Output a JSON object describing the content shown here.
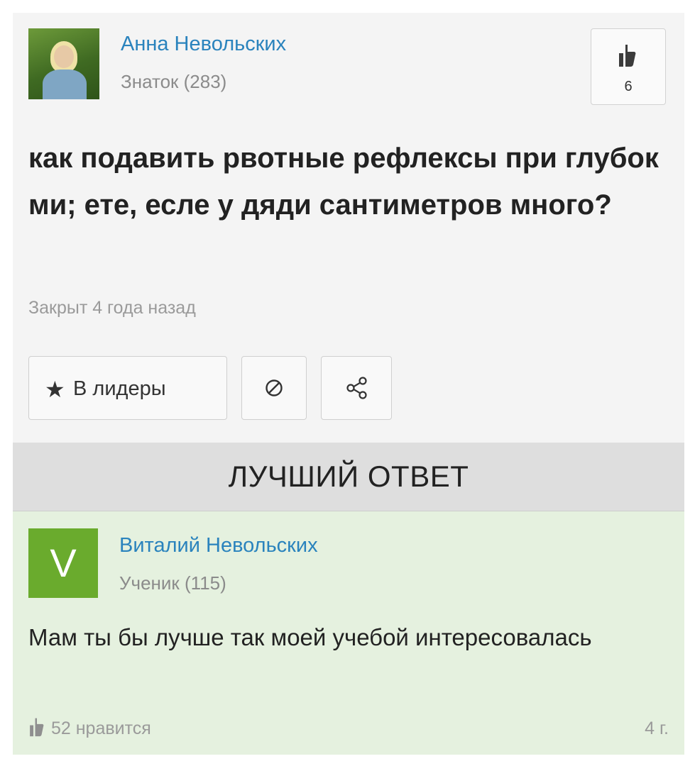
{
  "question": {
    "author_name": "Анна Невольских",
    "author_rank": "Знаток (283)",
    "like_count": "6",
    "text": "как подавить рвотные рефлексы при глубок ми; ете, есле у дяди сантиметров много?",
    "closed_text": "Закрыт 4 года назад",
    "leaders_button_label": "В лидеры",
    "star_icon": "★"
  },
  "best_answer": {
    "banner_title": "ЛУЧШИЙ ОТВЕТ",
    "avatar_letter": "V",
    "author_name": "Виталий Невольских",
    "author_rank": "Ученик (115)",
    "text": "Мам ты бы лучше так моей учебой интересовалась",
    "likes_label": "52 нравится",
    "age": "4 г."
  },
  "colors": {
    "link_blue": "#2a83bd",
    "answer_background": "#e5f1df",
    "avatar_green": "#6aab2d",
    "banner_gray": "#dedede"
  },
  "icons": [
    "thumbs-up-icon",
    "star-icon",
    "report-icon",
    "share-icon"
  ]
}
